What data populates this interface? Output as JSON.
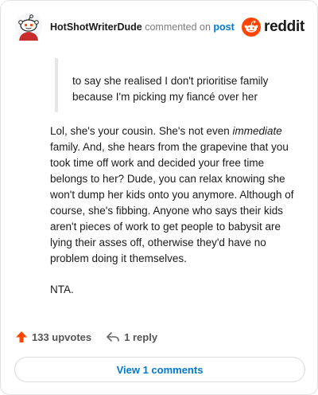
{
  "header": {
    "username": "HotShotWriterDude",
    "commented_text": "commented on",
    "post_link": "post",
    "brand": "reddit",
    "brand_color": "#ff4500"
  },
  "quote": {
    "lines": [
      "to say she realised I don't prioritise family",
      "because I'm picking my fiancé over her"
    ]
  },
  "comment": {
    "p1_before": "Lol, she's your cousin. She's not even ",
    "p1_emphasis": "immediate",
    "p1_after": " family. And, she hears from the grapevine that you took time off work and decided your free time belongs to her? Dude, you can relax knowing she won't dump her kids onto you anymore. Although of course, she's fibbing. Anyone who says their kids aren't pieces of work to get people to babysit are lying their asses off, otherwise they'd have no problem doing it themselves.",
    "p2": "NTA."
  },
  "actions": {
    "upvotes": "133 upvotes",
    "replies": "1 reply",
    "upvote_icon": "arrow-up-icon",
    "reply_icon": "reply-arrow-icon",
    "upvote_color": "#ff4500"
  },
  "footer": {
    "view_button": "View 1 comments"
  }
}
